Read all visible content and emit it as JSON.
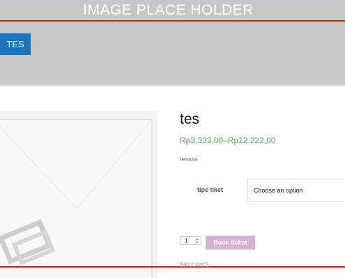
{
  "header": {
    "placeholder_text": "IMAGE PLACE HOLDER",
    "tag_label": "TES"
  },
  "product": {
    "title": "tes",
    "price": "Rp3.333,00–Rp12.222,00",
    "description": "tessss",
    "variation_label": "tipe tiket",
    "variation_selected": "Choose an option",
    "quantity": "1",
    "book_button": "Book ticket",
    "sku_text": "SKU: tes2"
  },
  "colors": {
    "banner": "#c7c7c7",
    "accent_blue": "#1e73be",
    "price_green": "#5ea65a",
    "book_button": "#d8b0d6",
    "guide_line": "#e2231a"
  },
  "icons": {
    "placeholder_image": "image-placeholder-icon"
  }
}
